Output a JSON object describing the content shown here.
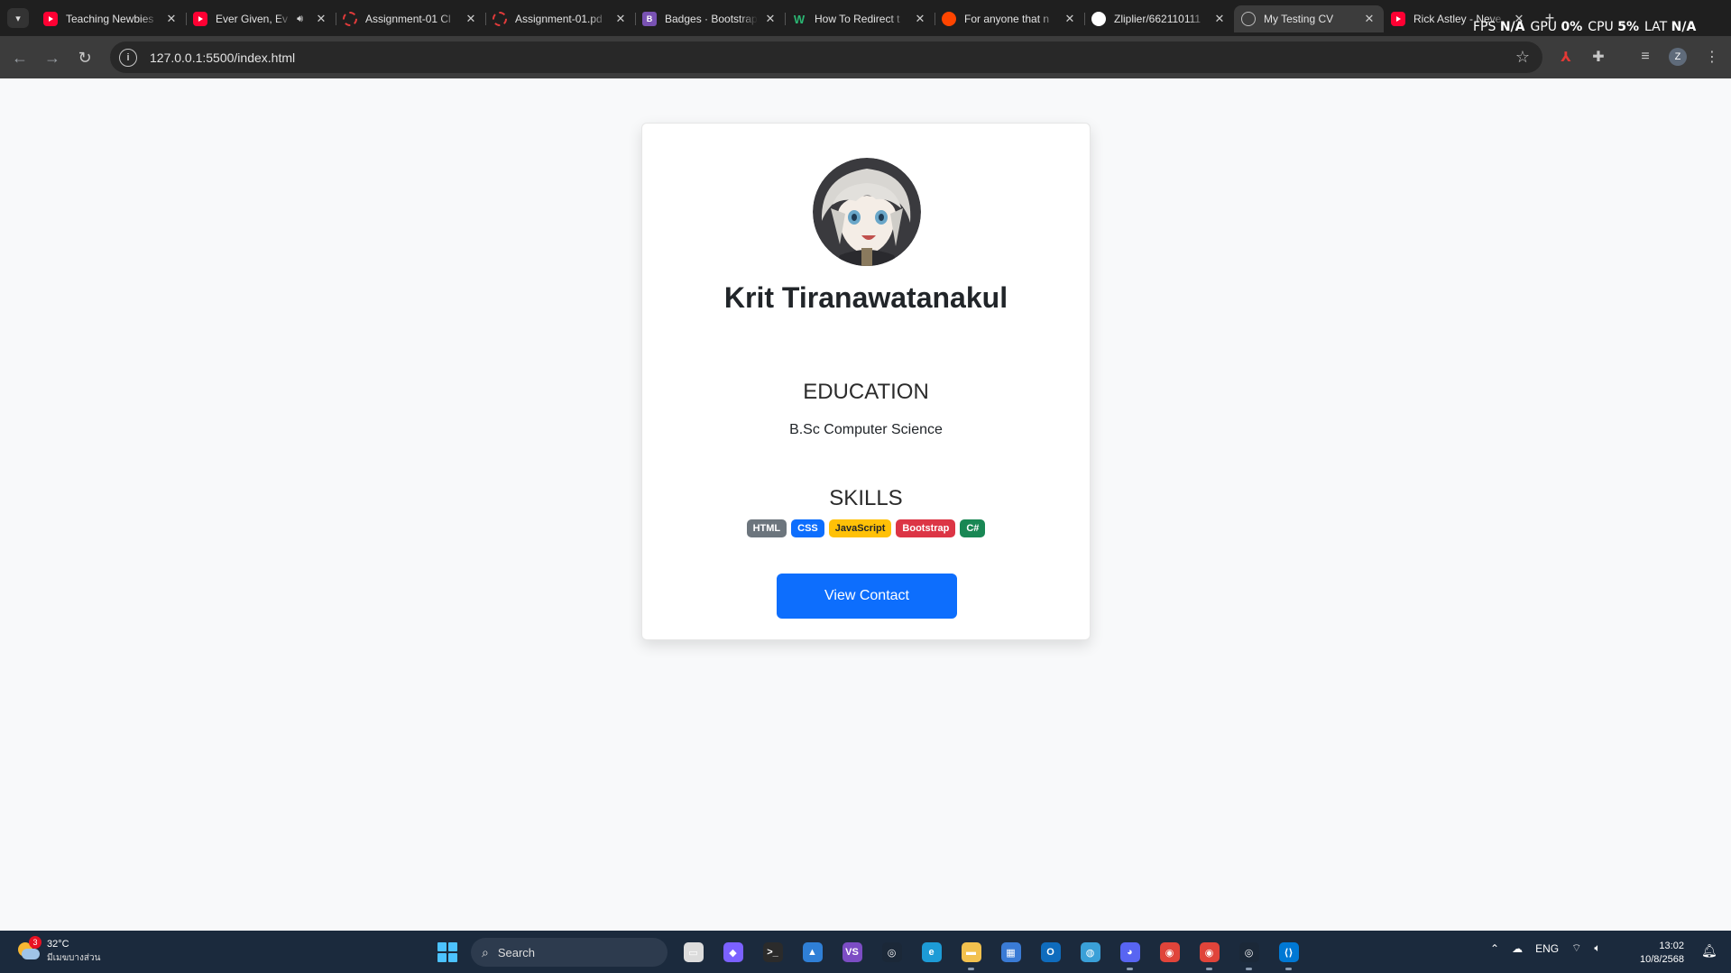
{
  "browser": {
    "tabs": [
      {
        "title": "Teaching Newbies",
        "favicon": "youtube-icon",
        "active": false,
        "audio": false
      },
      {
        "title": "Ever Given, Ev",
        "favicon": "youtube-icon",
        "active": false,
        "audio": true
      },
      {
        "title": "Assignment-01 Cl",
        "favicon": "ring-icon",
        "active": false,
        "audio": false
      },
      {
        "title": "Assignment-01.pd",
        "favicon": "ring-icon",
        "active": false,
        "audio": false
      },
      {
        "title": "Badges · Bootstrap",
        "favicon": "bootstrap-icon",
        "active": false,
        "audio": false
      },
      {
        "title": "How To Redirect t",
        "favicon": "w-icon",
        "active": false,
        "audio": false
      },
      {
        "title": "For anyone that n",
        "favicon": "reddit-icon",
        "active": false,
        "audio": false
      },
      {
        "title": "Zliplier/662110111",
        "favicon": "github-icon",
        "active": false,
        "audio": false
      },
      {
        "title": "My Testing CV",
        "favicon": "globe-icon",
        "active": true,
        "audio": false
      },
      {
        "title": "Rick Astley - Neve",
        "favicon": "youtube-icon",
        "active": false,
        "audio": false
      }
    ],
    "url": "127.0.0.1:5500/index.html",
    "profile_initial": "Z"
  },
  "overlay": {
    "fps_label": "FPS",
    "fps_value": "N/A",
    "gpu_label": "GPU",
    "gpu_value": "0%",
    "cpu_label": "CPU",
    "cpu_value": "5%",
    "lat_label": "LAT",
    "lat_value": "N/A"
  },
  "page": {
    "name": "Krit Tiranawatanakul",
    "education": {
      "title": "EDUCATION",
      "items": [
        "B.Sc Computer Science"
      ]
    },
    "skills": {
      "title": "SKILLS",
      "badges": [
        {
          "label": "HTML",
          "color": "#6c757d",
          "text_color": "#ffffff"
        },
        {
          "label": "CSS",
          "color": "#0d6efd",
          "text_color": "#ffffff"
        },
        {
          "label": "JavaScript",
          "color": "#ffc107",
          "text_color": "#212529"
        },
        {
          "label": "Bootstrap",
          "color": "#dc3545",
          "text_color": "#ffffff"
        },
        {
          "label": "C#",
          "color": "#198754",
          "text_color": "#ffffff"
        }
      ]
    },
    "contact_button": "View Contact"
  },
  "taskbar": {
    "weather_temp": "32°C",
    "weather_desc": "มีเมฆบางส่วน",
    "weather_badge": "3",
    "search_placeholder": "Search",
    "apps": [
      {
        "name": "file-explorer-window-icon",
        "color": "#dcdcdc",
        "glyph": "▭",
        "running": false
      },
      {
        "name": "copilot-icon",
        "color": "#7b61ff",
        "glyph": "◆",
        "running": false
      },
      {
        "name": "terminal-icon",
        "color": "#2b2b2b",
        "glyph": ">_",
        "running": false
      },
      {
        "name": "photos-icon",
        "color": "#2f7fd6",
        "glyph": "▲",
        "running": false
      },
      {
        "name": "visual-studio-icon",
        "color": "#7c4dc4",
        "glyph": "VS",
        "running": false
      },
      {
        "name": "steam-icon",
        "color": "#1b2838",
        "glyph": "◎",
        "running": false
      },
      {
        "name": "edge-icon",
        "color": "#1d9bd6",
        "glyph": "e",
        "running": false
      },
      {
        "name": "folder-icon",
        "color": "#f2c14e",
        "glyph": "▬",
        "running": true
      },
      {
        "name": "store-icon",
        "color": "#3a7bd5",
        "glyph": "▦",
        "running": false
      },
      {
        "name": "outlook-icon",
        "color": "#0f6cbd",
        "glyph": "O",
        "running": false
      },
      {
        "name": "globe-app-icon",
        "color": "#3aa0d8",
        "glyph": "◍",
        "running": false
      },
      {
        "name": "discord-icon",
        "color": "#5865f2",
        "glyph": "◕",
        "running": true
      },
      {
        "name": "chrome-icon",
        "color": "#e0443a",
        "glyph": "◉",
        "running": false
      },
      {
        "name": "chrome-profile-icon",
        "color": "#e0443a",
        "glyph": "◉",
        "running": true
      },
      {
        "name": "steam-client-icon",
        "color": "#1b2838",
        "glyph": "◎",
        "running": true
      },
      {
        "name": "vscode-icon",
        "color": "#0078d4",
        "glyph": "⟨⟩",
        "running": true
      }
    ],
    "language": "ENG",
    "time": "13:02",
    "date": "10/8/2568"
  }
}
